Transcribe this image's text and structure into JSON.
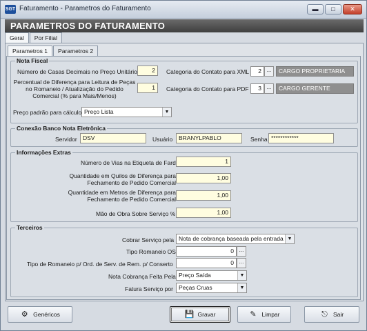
{
  "window": {
    "title": "Faturamento  - Parametros do Faturamento",
    "icon_text": "SGT",
    "minimize_glyph": "▬",
    "maximize_glyph": "□",
    "close_glyph": "✕"
  },
  "header": {
    "title": "PARAMETROS DO FATURAMENTO"
  },
  "outer_tabs": [
    {
      "label": "Geral"
    },
    {
      "label": "Por Filial"
    }
  ],
  "inner_tabs": [
    {
      "label": "Parametros 1"
    },
    {
      "label": "Parametros 2"
    }
  ],
  "nota_fiscal": {
    "legend": "Nota Fiscal",
    "casas_decimais_label": "Número de Casas Decimais no Preço Unitário",
    "casas_decimais_value": "2",
    "percentual_label": "Percentual de Diferença para Leitura de Peças no Romaneio / Atualização do Pedido Comercial (% para Mais/Menos)",
    "percentual_value": "1",
    "cat_xml_label": "Categoria do Contato para XML",
    "cat_xml_code": "2",
    "cat_xml_desc": "CARGO PROPRIETARIA",
    "cat_pdf_label": "Categoria do Contato para PDF",
    "cat_pdf_code": "3",
    "cat_pdf_desc": "CARGO GERENTE",
    "preco_label": "Preço padrão para cálculo",
    "preco_value": "Preço Lista",
    "ellipsis": "..."
  },
  "conexao": {
    "legend": "Conexão  Banco Nota Eletrônica",
    "servidor_label": "Servidor",
    "servidor_value": "DSV",
    "usuario_label": "Usuário",
    "usuario_value": "BRANYLPABLO",
    "senha_label": "Senha",
    "senha_value": "************"
  },
  "informacoes": {
    "legend": "Informações Extras",
    "vias_label": "Número de Vias na Etiqueta de Fardo",
    "vias_value": "1",
    "quilos_label": "Quantidade em Quilos de Diferença para Fechamento de Pedido Comercial",
    "quilos_value": "1,00",
    "metros_label": "Quantidade em Metros de Diferença para Fechamento de Pedido Comercial",
    "metros_value": "1,00",
    "mao_obra_label": "Mão de Obra Sobre Serviço %",
    "mao_obra_value": "1,00"
  },
  "terceiros": {
    "legend": "Terceiros",
    "cobrar_label": "Cobrar Serviço pela",
    "cobrar_value": "Nota de cobrança baseada pela entrada",
    "tipo_romaneio_label": "Tipo Romaneio OS",
    "tipo_romaneio_value": "0",
    "tipo_romaneio_conserto_label": "Tipo de Romaneio p/ Ord. de Serv. de Rem. p/ Conserto",
    "tipo_romaneio_conserto_value": "0",
    "nota_cobranca_label": "Nota Cobrança Feita Pela",
    "nota_cobranca_value": "Preço Saída",
    "fatura_label": "Fatura Serviço por",
    "fatura_value": "Peças Cruas",
    "ellipsis": "..."
  },
  "buttons": {
    "genericos": "Genéricos",
    "gravar": "Gravar",
    "limpar": "Limpar",
    "sair": "Sair"
  },
  "colors": {
    "field_yellow": "#fffde0",
    "banner_dark": "#4a4a4a",
    "readonly_grey": "#8f8f8f"
  }
}
